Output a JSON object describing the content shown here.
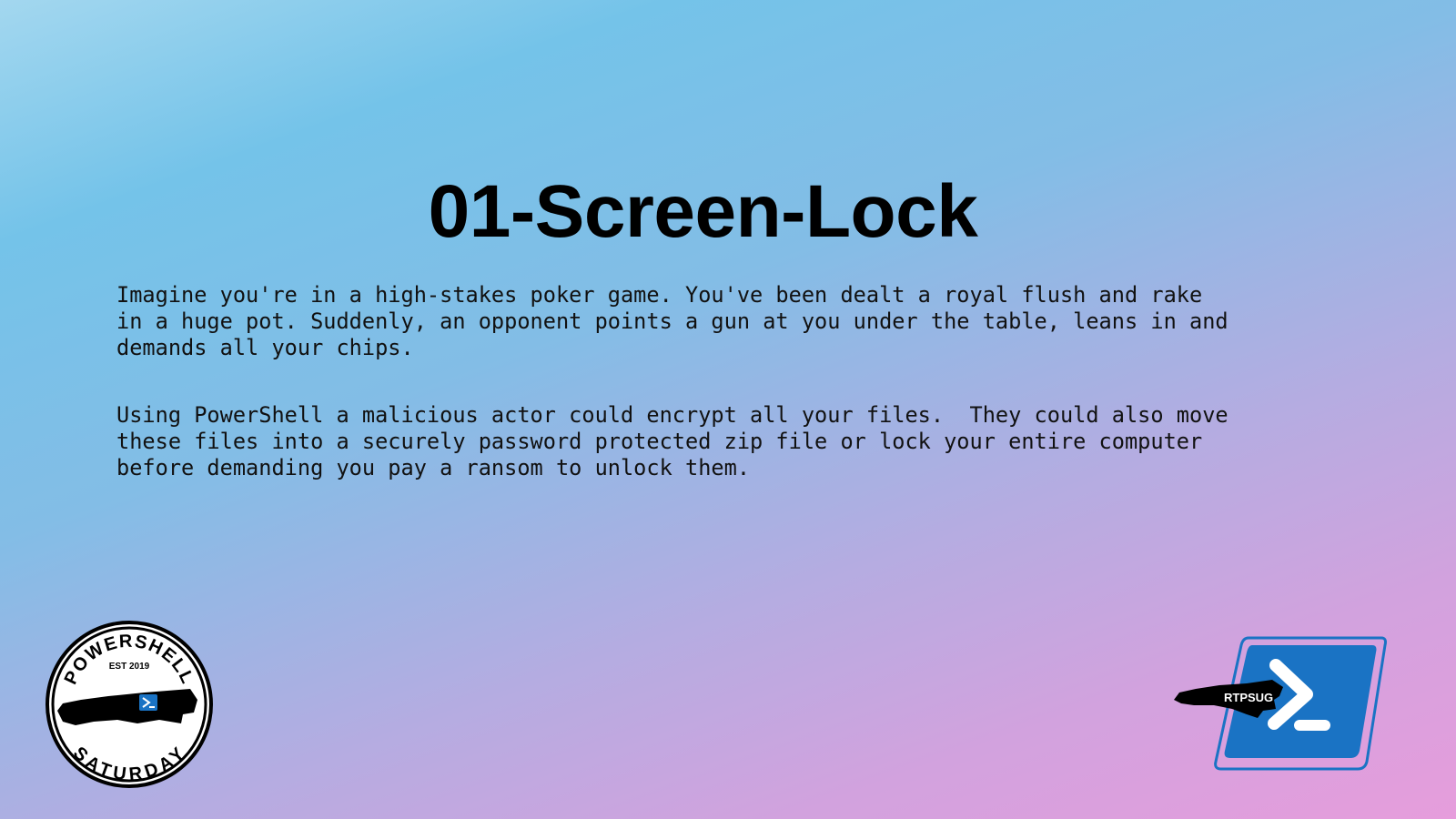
{
  "slide": {
    "title": "01-Screen-Lock",
    "paragraphs": [
      "Imagine you're in a high-stakes poker game. You've been dealt a royal flush and rake\nin a huge pot. Suddenly, an opponent points a gun at you under the table, leans in and\ndemands all your chips.",
      "Using PowerShell a malicious actor could encrypt all your files.  They could also move\nthese files into a securely password protected zip file or lock your entire computer\nbefore demanding you pay a ransom to unlock them."
    ]
  },
  "logos": {
    "left": {
      "top_text": "POWERSHELL",
      "est_text": "EST 2019",
      "bottom_text": "SATURDAY",
      "icon": "powershell-prompt-icon"
    },
    "right": {
      "label": "RTPSUG",
      "icon": "powershell-prompt-icon"
    }
  },
  "colors": {
    "gradient_start": "#a3d7ef",
    "gradient_mid": "#83bde6",
    "gradient_end": "#e69ddc",
    "powershell_blue": "#1a73c4",
    "text": "#111111"
  }
}
